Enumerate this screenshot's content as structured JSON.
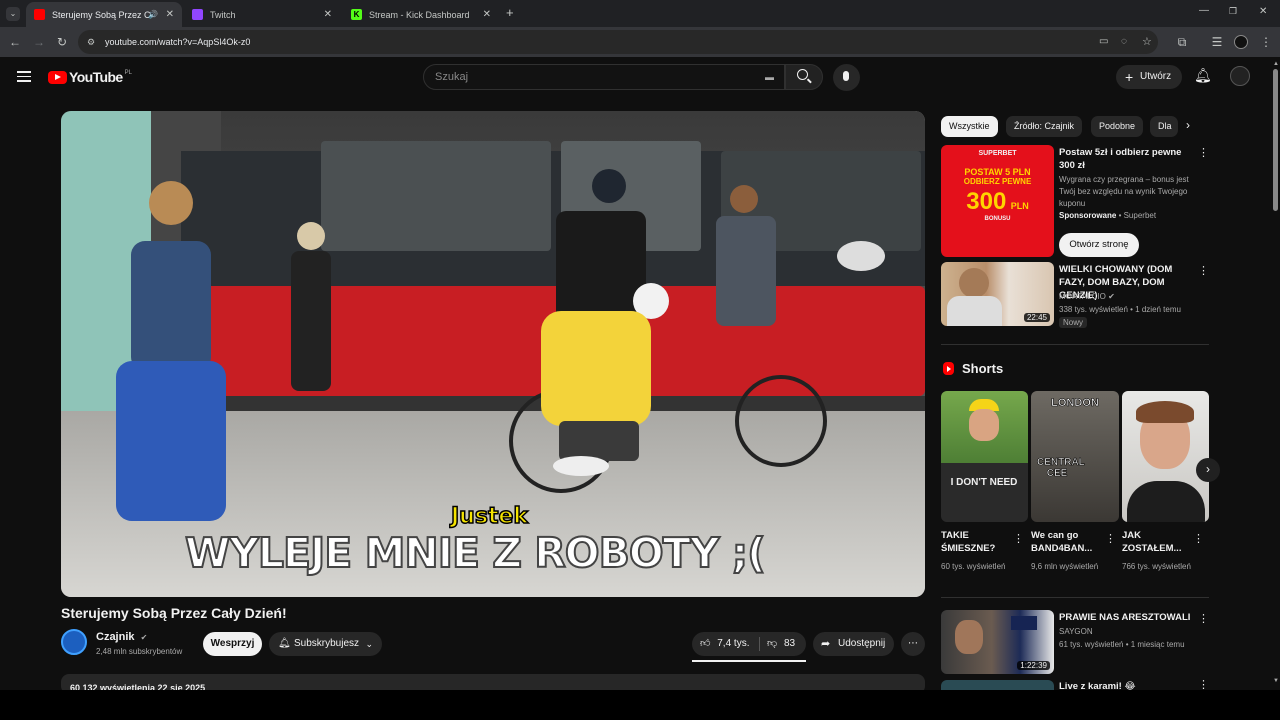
{
  "browser": {
    "tabs": [
      {
        "title": "Sterujemy Sobą Przez Cały D",
        "color": "#ff0000",
        "active": true
      },
      {
        "title": "Twitch",
        "color": "#9146ff"
      },
      {
        "title": "Stream - Kick Dashboard",
        "color": "#53fc18"
      }
    ],
    "url": "youtube.com/watch?v=AqpSl4Ok-z0"
  },
  "youtube": {
    "logo_text": "YouTube",
    "region": "PL",
    "search_placeholder": "Szukaj",
    "create_label": "Utwórz"
  },
  "video": {
    "title": "Sterujemy Sobą Przez Cały Dzień!",
    "overlay_name": "Justek",
    "overlay_caption": "WYLEJE MNIE Z ROBOTY ;(",
    "channel_name": "Czajnik",
    "subscribers": "2,48 mln subskrybentów",
    "support_label": "Wesprzyj",
    "subscribed_label": "Subskrybujesz",
    "likes": "7,4 tys.",
    "dislikes": "83",
    "share_label": "Udostępnij",
    "description_stats": "60 132 wyświetlenia  22 sie 2025"
  },
  "sidebar": {
    "chips": [
      "Wszystkie",
      "Źródło: Czajnik",
      "Podobne",
      "Dla"
    ],
    "ad": {
      "title": "Postaw 5zł i odbierz pewne 300 zł",
      "description": "Wygrana czy przegrana – bonus jest Twój bez względu na wynik Twojego kuponu",
      "sponsored": "Sponsorowane",
      "advertiser": "Superbet",
      "cta": "Otwórz stronę",
      "banner_brand": "SUPERBET",
      "banner_line1": "POSTAW 5 PLN",
      "banner_line2": "ODBIERZ PEWNE",
      "banner_amount": "300",
      "banner_currency": "PLN",
      "banner_bonus": "BONUSU"
    },
    "videos": [
      {
        "title": "WIELKI CHOWANY (DOM FAZY, DOM BAZY, DOM GENZIE)",
        "channel": "MORTALCIO",
        "meta": "338 tys. wyświetleń • 1 dzień temu",
        "badge": "Nowy",
        "duration": "22:45"
      },
      {
        "title": "PRAWIE NAS ARESZTOWALI",
        "channel": "SAYGON",
        "meta": "61 tys. wyświetleń • 1 miesiąc temu",
        "duration": "1:22:39"
      },
      {
        "title": "Live z karami! 😂"
      }
    ],
    "shorts_heading": "Shorts",
    "shorts": [
      {
        "title": "TAKIE ŚMIESZNE?",
        "views": "60 tys. wyświetleń",
        "overlay": "I DON'T NEED"
      },
      {
        "title": "We can go BAND4BAN...",
        "views": "9,6 mln wyświetleń",
        "overlay_top": "LONDON",
        "overlay": "CENTRAL CEE"
      },
      {
        "title": "JAK ZOSTAŁEM...",
        "views": "766 tys. wyświetleń"
      }
    ]
  },
  "colors": {
    "youtube_red": "#ff0000",
    "background": "#0f0f0f",
    "caption_yellow": "#f5e400"
  }
}
